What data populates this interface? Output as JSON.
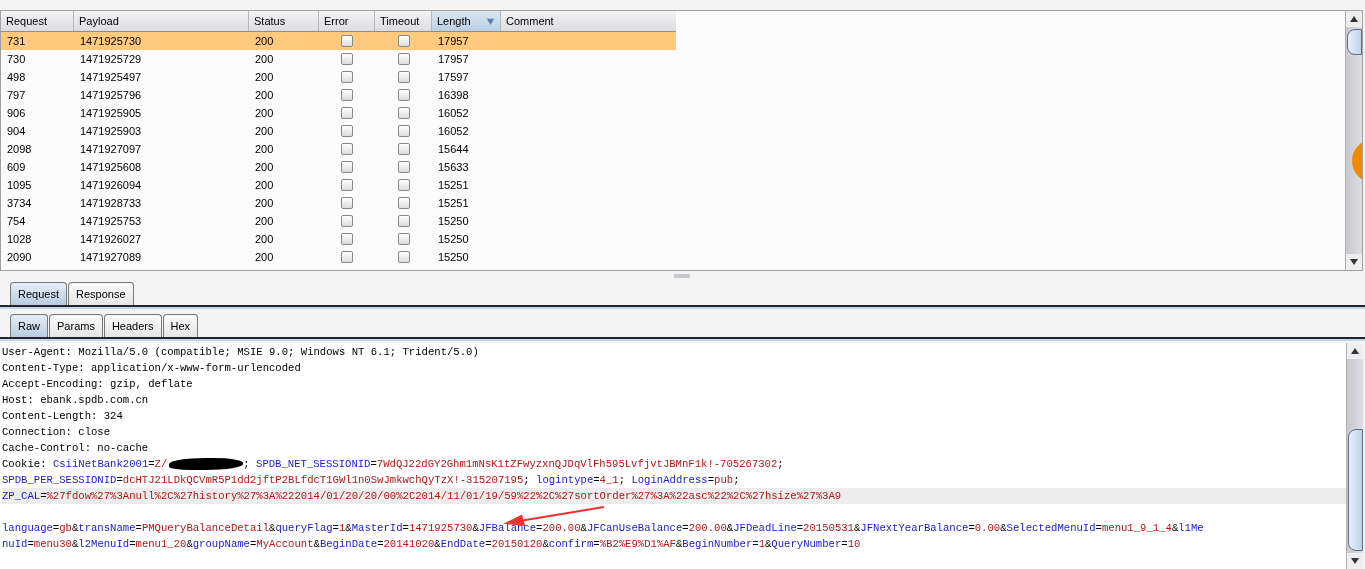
{
  "results_table": {
    "columns": [
      {
        "label": "Request",
        "sorted": false
      },
      {
        "label": "Payload",
        "sorted": false
      },
      {
        "label": "Status",
        "sorted": false
      },
      {
        "label": "Error",
        "sorted": false
      },
      {
        "label": "Timeout",
        "sorted": false
      },
      {
        "label": "Length",
        "sorted": true
      },
      {
        "label": "Comment",
        "sorted": false
      }
    ],
    "rows": [
      {
        "request": "731",
        "payload": "1471925730",
        "status": "200",
        "error": false,
        "timeout": false,
        "length": "17957",
        "selected": true
      },
      {
        "request": "730",
        "payload": "1471925729",
        "status": "200",
        "error": false,
        "timeout": false,
        "length": "17957",
        "selected": false
      },
      {
        "request": "498",
        "payload": "1471925497",
        "status": "200",
        "error": false,
        "timeout": false,
        "length": "17597",
        "selected": false
      },
      {
        "request": "797",
        "payload": "1471925796",
        "status": "200",
        "error": false,
        "timeout": false,
        "length": "16398",
        "selected": false
      },
      {
        "request": "906",
        "payload": "1471925905",
        "status": "200",
        "error": false,
        "timeout": false,
        "length": "16052",
        "selected": false
      },
      {
        "request": "904",
        "payload": "1471925903",
        "status": "200",
        "error": false,
        "timeout": false,
        "length": "16052",
        "selected": false
      },
      {
        "request": "2098",
        "payload": "1471927097",
        "status": "200",
        "error": false,
        "timeout": false,
        "length": "15644",
        "selected": false
      },
      {
        "request": "609",
        "payload": "1471925608",
        "status": "200",
        "error": false,
        "timeout": false,
        "length": "15633",
        "selected": false
      },
      {
        "request": "1095",
        "payload": "1471926094",
        "status": "200",
        "error": false,
        "timeout": false,
        "length": "15251",
        "selected": false
      },
      {
        "request": "3734",
        "payload": "1471928733",
        "status": "200",
        "error": false,
        "timeout": false,
        "length": "15251",
        "selected": false
      },
      {
        "request": "754",
        "payload": "1471925753",
        "status": "200",
        "error": false,
        "timeout": false,
        "length": "15250",
        "selected": false
      },
      {
        "request": "1028",
        "payload": "1471926027",
        "status": "200",
        "error": false,
        "timeout": false,
        "length": "15250",
        "selected": false
      },
      {
        "request": "2090",
        "payload": "1471927089",
        "status": "200",
        "error": false,
        "timeout": false,
        "length": "15250",
        "selected": false
      }
    ]
  },
  "message_tabs": [
    {
      "label": "Request",
      "selected": true
    },
    {
      "label": "Response",
      "selected": false
    }
  ],
  "view_tabs": [
    {
      "label": "Raw",
      "selected": true
    },
    {
      "label": "Params",
      "selected": false
    },
    {
      "label": "Headers",
      "selected": false
    },
    {
      "label": "Hex",
      "selected": false
    }
  ],
  "raw_lines": [
    {
      "kind": "plain",
      "highlighted": false,
      "text": "User-Agent: Mozilla/5.0 (compatible; MSIE 9.0; Windows NT 6.1; Trident/5.0)"
    },
    {
      "kind": "plain",
      "highlighted": false,
      "text": "Content-Type: application/x-www-form-urlencoded"
    },
    {
      "kind": "plain",
      "highlighted": false,
      "text": "Accept-Encoding: gzip, deflate"
    },
    {
      "kind": "plain",
      "highlighted": false,
      "text": "Host: ebank.spdb.com.cn"
    },
    {
      "kind": "plain",
      "highlighted": false,
      "text": "Content-Length: 324"
    },
    {
      "kind": "plain",
      "highlighted": false,
      "text": "Connection: close"
    },
    {
      "kind": "plain",
      "highlighted": false,
      "text": "Cache-Control: no-cache"
    },
    {
      "kind": "segments",
      "highlighted": false,
      "segments": [
        {
          "kind": "plain",
          "text": "Cookie:"
        },
        {
          "kind": "name",
          "text": "CsiiNetBank2001"
        },
        {
          "kind": "plain",
          "text": "="
        },
        {
          "kind": "value",
          "text": "Z/"
        },
        {
          "kind": "redaction"
        },
        {
          "kind": "plain",
          "text": ";"
        },
        {
          "kind": "name",
          "text": "SPDB_NET_SESSIONID"
        },
        {
          "kind": "plain",
          "text": "="
        },
        {
          "kind": "value",
          "text": "7WdQJ22dGY2Ghm1mNsK1tZFwyzxnQJDqVlFh595LvfjvtJBMnF1k!-705267302"
        },
        {
          "kind": "plain",
          "text": ";"
        }
      ]
    },
    {
      "kind": "segments",
      "highlighted": false,
      "segments": [
        {
          "kind": "name",
          "text": "SPDB_PER_SESSIONID"
        },
        {
          "kind": "plain",
          "text": "="
        },
        {
          "kind": "value",
          "text": "dcHTJ21LDkQCVmR5P1dd2jftP2BLfdcT1GWl1n0SwJmkwchQyTzX!-315207195"
        },
        {
          "kind": "plain",
          "text": ";"
        },
        {
          "kind": "name",
          "text": "logintype"
        },
        {
          "kind": "plain",
          "text": "="
        },
        {
          "kind": "value",
          "text": "4_1"
        },
        {
          "kind": "plain",
          "text": ";"
        },
        {
          "kind": "name",
          "text": "LoginAddress"
        },
        {
          "kind": "plain",
          "text": "="
        },
        {
          "kind": "value",
          "text": "pub"
        },
        {
          "kind": "plain",
          "text": ";"
        }
      ]
    },
    {
      "kind": "segments",
      "highlighted": true,
      "segments": [
        {
          "kind": "name",
          "text": "ZP_CAL"
        },
        {
          "kind": "plain",
          "text": "="
        },
        {
          "kind": "value",
          "text": "%27fdow%27%3Anull%2C%27history%27%3A%222014/01/20/20/00%2C2014/11/01/19/59%22%2C%27sortOrder%27%3A%22asc%22%2C%27hsize%27%3A9"
        }
      ]
    },
    {
      "kind": "blank"
    },
    {
      "kind": "params",
      "highlighted": false,
      "text": "language=gb&transName=PMQueryBalanceDetail&queryFlag=1&MasterId=1471925730&JFBalance=200.00&JFCanUseBalance=200.00&JFDeadLine=20150531&JFNextYearBalance=0.00&SelectedMenuId=menu1_9_1_4&l1Me"
    },
    {
      "kind": "params",
      "highlighted": false,
      "text": "nuId=menu30&l2MenuId=menu1_20&groupName=MyAccount&BeginDate=20141020&EndDate=20150120&confirm=%B2%E9%D1%AF&BeginNumber=1&QueryNumber=10"
    }
  ]
}
